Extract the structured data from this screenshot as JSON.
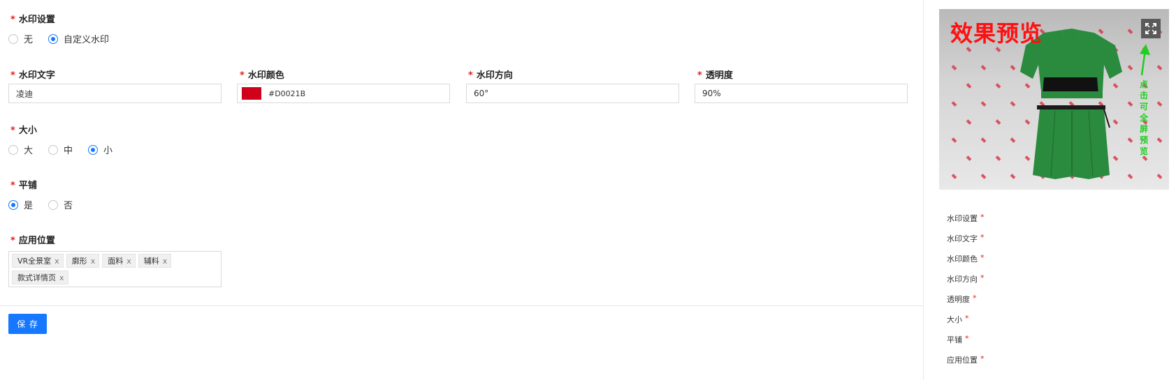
{
  "form": {
    "watermark_setting": {
      "label": "水印设置",
      "options": [
        "无",
        "自定义水印"
      ],
      "selected": 1
    },
    "watermark_text": {
      "label": "水印文字",
      "value": "凌迪"
    },
    "watermark_color": {
      "label": "水印颜色",
      "value": "#D0021B",
      "swatch": "#D0021B"
    },
    "watermark_direction": {
      "label": "水印方向",
      "value": "60°"
    },
    "opacity": {
      "label": "透明度",
      "value": "90%"
    },
    "size": {
      "label": "大小",
      "options": [
        "大",
        "中",
        "小"
      ],
      "selected": 2
    },
    "tile": {
      "label": "平铺",
      "options": [
        "是",
        "否"
      ],
      "selected": 0
    },
    "apply_position": {
      "label": "应用位置",
      "tags": [
        "VR全景室",
        "廓形",
        "面料",
        "辅料",
        "款式详情页"
      ],
      "remove_glyph": "x"
    },
    "required_mark": "*"
  },
  "footer": {
    "save_label": "保 存"
  },
  "preview": {
    "title": "效果预览",
    "tip": "点击可全屏预览",
    "expand_icon": "expand-icon",
    "garment_color": "#2a8a3e"
  },
  "settings_list": {
    "items": [
      "水印设置",
      "水印文字",
      "水印颜色",
      "水印方向",
      "透明度",
      "大小",
      "平铺",
      "应用位置"
    ]
  },
  "colors": {
    "primary": "#1677ff",
    "required": "#e02020",
    "preview_title": "#ff1010",
    "tip": "#22cc22"
  }
}
